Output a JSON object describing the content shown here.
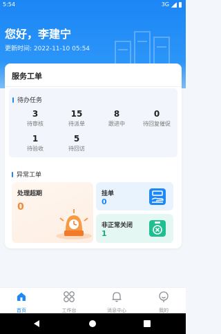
{
  "status_bar": {
    "time": "5:54",
    "network": "3G"
  },
  "header": {
    "greeting": "您好，李建宁",
    "updated_label": "更新时间:",
    "updated_time": "2022-11-10 05:54"
  },
  "service_card": {
    "title": "服务工单",
    "pending_section": {
      "label": "待办任务",
      "stats": [
        {
          "value": "3",
          "label": "待审核"
        },
        {
          "value": "15",
          "label": "待派单"
        },
        {
          "value": "8",
          "label": "跟进中"
        },
        {
          "value": "0",
          "label": "待回复催促"
        },
        {
          "value": "1",
          "label": "待验收"
        },
        {
          "value": "5",
          "label": "待回访"
        }
      ]
    },
    "abnormal_section": {
      "label": "异常工单",
      "overdue": {
        "label": "处理超期",
        "value": "0"
      },
      "hang": {
        "label": "挂单",
        "value": "0"
      },
      "abnormal_close": {
        "label": "非正常关闭",
        "value": "1"
      }
    }
  },
  "bottom_nav": {
    "items": [
      {
        "label": "首页",
        "icon": "home-icon",
        "active": true
      },
      {
        "label": "工作台",
        "icon": "grid-icon",
        "active": false
      },
      {
        "label": "消息中心",
        "icon": "bell-icon",
        "active": false
      },
      {
        "label": "我的",
        "icon": "user-icon",
        "active": false
      }
    ]
  },
  "colors": {
    "brand": "#1e88f4",
    "overdue_value": "#f08a3c",
    "hang_value": "#1e88f4",
    "close_value": "#1aa784"
  }
}
